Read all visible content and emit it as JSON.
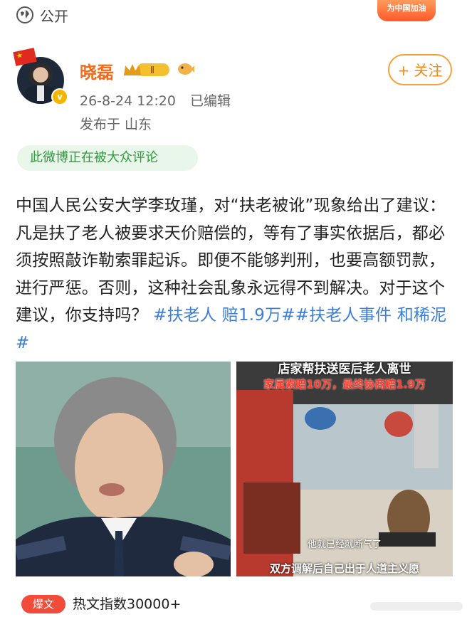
{
  "topbar": {
    "visibility_label": "公开",
    "promo_badge": "为中国加油"
  },
  "user": {
    "name": "晓磊",
    "level_badge": "Ⅱ",
    "follow_label": "+ 关注"
  },
  "meta": {
    "time": "26-8-24 12:20",
    "edited": "已编辑",
    "location": "发布于 山东"
  },
  "discuss_badge": "此微博正在被大众评论",
  "post": {
    "text_before": "中国人民公安大学李玫瑾，对“扶老被讹”现象给出了建议：凡是扶了老人被要求天价赔偿的，等有了事实依据后，都必须按照敲诈勒索罪起诉。即便不能够判刑，也要高额罚款，进行严惩。否则，这种社会乱象永远得不到解决。对于这个建议，你支持吗？",
    "tags": [
      "#扶老人 赔1.9万#",
      "#扶老人事件 和稀泥#"
    ]
  },
  "image_right": {
    "headline1": "店家帮扶送医后老人离世",
    "headline2": "家属索赔10万，最终协商赔1.9万",
    "subtitle1": "他就已经就断气了",
    "subtitle2": "双方调解后自己出于人道主义愿"
  },
  "hot": {
    "pill": "爆文",
    "text": "热文指数30000+"
  },
  "colors": {
    "accent_orange": "#f06b1c",
    "tag_blue": "#3d7fd6",
    "discuss_green": "#2e9a3c",
    "hot_red": "#f24b3a"
  },
  "icons": [
    "globe-icon",
    "verified-icon",
    "crown-badge-icon",
    "fish-icon",
    "flag-icon"
  ]
}
